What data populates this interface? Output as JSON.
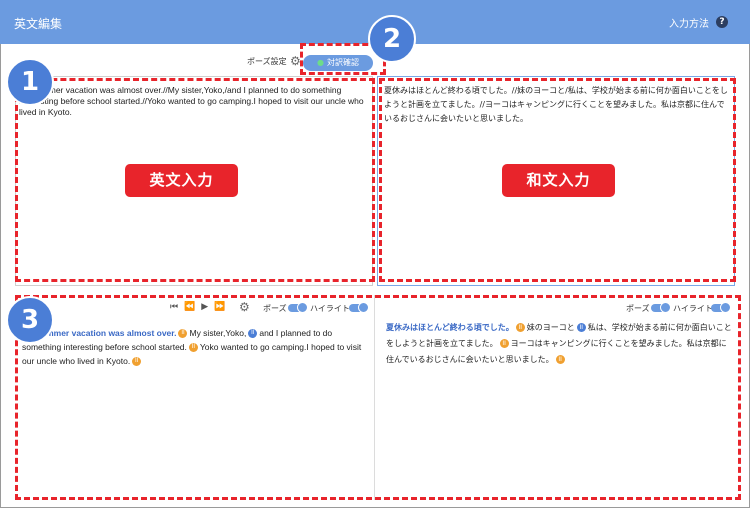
{
  "header": {
    "title": "英文編集",
    "input_method": "入力方法",
    "help_icon": "?"
  },
  "toolbar": {
    "pause_label": "ポーズ設定",
    "confirm_label": "対訳確認"
  },
  "editor": {
    "english_text": "My summer vacation was almost over.//My sister,Yoko,/and I planned to do something interesting before school started.//Yoko wanted to go camping.I hoped to visit our uncle who lived in Kyoto.",
    "japanese_text": "夏休みはほとんど終わる頃でした。//妹のヨーコと/私は、学校が始まる前に何か面白いことをしようと計画を立てました。//ヨーコはキャンピングに行くことを望みました。私は京都に住んでいるおじさんに会いたいと思いました。",
    "english_label": "英文入力",
    "japanese_label": "和文入力"
  },
  "preview": {
    "pause_label": "ポーズ",
    "highlight_label": "ハイライト",
    "pause_glyph": "II",
    "english_segments": [
      {
        "text": "My summer vacation was almost over.",
        "highlight": true
      },
      {
        "pause": "orange"
      },
      {
        "text": "My sister,Yoko,"
      },
      {
        "pause": "blue"
      },
      {
        "text": "and I planned to do something interesting before school started."
      },
      {
        "pause": "orange"
      },
      {
        "text": "Yoko wanted to go camping.I hoped to visit our uncle who lived in Kyoto."
      },
      {
        "pause": "orange"
      }
    ],
    "japanese_segments": [
      {
        "text": "夏休みはほとんど終わる頃でした。",
        "highlight": true
      },
      {
        "pause": "orange"
      },
      {
        "text": "妹のヨーコと"
      },
      {
        "pause": "blue"
      },
      {
        "text": "私は、学校が始まる前に何か面白いことをしようと計画を立てました。"
      },
      {
        "pause": "orange"
      },
      {
        "text": "ヨーコはキャンピングに行くことを望みました。私は京都に住んでいるおじさんに会いたいと思いました。"
      },
      {
        "pause": "orange"
      }
    ]
  },
  "callouts": [
    "1",
    "2",
    "3"
  ],
  "colors": {
    "header": "#6b9be0",
    "annotation_red": "#e8242b",
    "callout_blue": "#4b7ed6",
    "highlight_text": "#3a69c5",
    "pause_orange": "#f0a030"
  }
}
